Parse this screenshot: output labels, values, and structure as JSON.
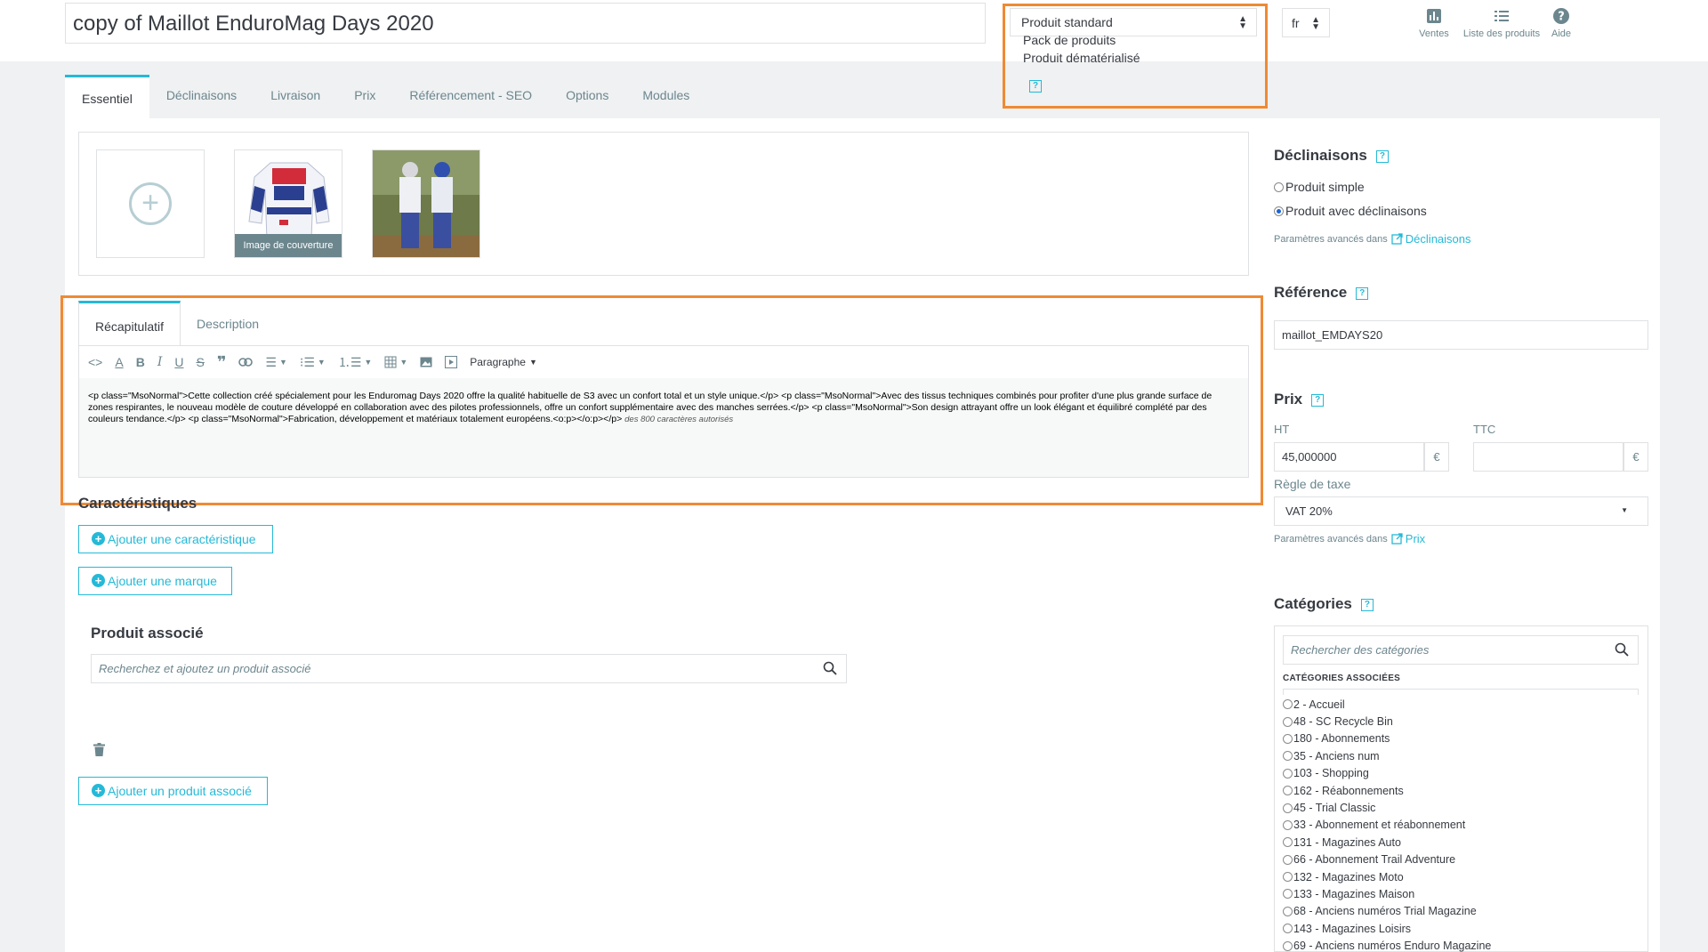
{
  "header": {
    "product_name": "copy of Maillot EnduroMag Days 2020",
    "type_selected": "Produit standard",
    "type_options": [
      "Pack de produits",
      "Produit dématérialisé"
    ],
    "language": "fr",
    "links": [
      {
        "label": "Ventes",
        "icon": "bar-chart-icon"
      },
      {
        "label": "Liste des produits",
        "icon": "list-icon"
      },
      {
        "label": "Aide",
        "icon": "help-icon"
      }
    ]
  },
  "tabs": [
    "Essentiel",
    "Déclinaisons",
    "Livraison",
    "Prix",
    "Référencement - SEO",
    "Options",
    "Modules"
  ],
  "images": {
    "cover_label": "Image de couverture"
  },
  "summary": {
    "tabs": [
      "Récapitulatif",
      "Description"
    ],
    "format_label": "Paragraphe",
    "content": "<p class=\"MsoNormal\">Cette collection créé spécialement pour les Enduromag Days 2020 offre la qualité habituelle de S3 avec un confort total et un style unique.</p> <p class=\"MsoNormal\">Avec des tissus techniques combinés pour profiter d'une plus grande surface de zones respirantes, le nouveau modèle de couture développé en collaboration avec des pilotes professionnels, offre un confort supplémentaire avec des manches serrées.</p> <p class=\"MsoNormal\">Son design attrayant offre un look élégant et équilibré complété par des couleurs tendance.</p> <p class=\"MsoNormal\">Fabrication, développement et matériaux totalement européens.<o:p></o:p></p>",
    "limit_text": "des 800 caractères autorisés"
  },
  "characteristics": {
    "title": "Caractéristiques",
    "add_feature": "Ajouter une caractéristique",
    "add_brand": "Ajouter une marque"
  },
  "related": {
    "title": "Produit associé",
    "placeholder": "Recherchez et ajoutez un produit associé",
    "add_button": "Ajouter un produit associé"
  },
  "variants": {
    "title": "Déclinaisons",
    "option_simple": "Produit simple",
    "option_combinations": "Produit avec déclinaisons",
    "advanced_prefix": "Paramètres avancés dans",
    "advanced_link": "Déclinaisons"
  },
  "reference": {
    "title": "Référence",
    "value": "maillot_EMDAYS20"
  },
  "price": {
    "title": "Prix",
    "ht_label": "HT",
    "ttc_label": "TTC",
    "ht_value": "45,000000",
    "currency": "€",
    "tax_label": "Règle de taxe",
    "tax_value": "VAT 20%",
    "advanced_prefix": "Paramètres avancés dans",
    "advanced_link": "Prix"
  },
  "categories": {
    "title": "Catégories",
    "search_placeholder": "Rechercher des catégories",
    "associated_label": "CATÉGORIES ASSOCIÉES",
    "items": [
      "2 - Accueil",
      "48 - SC Recycle Bin",
      "180 - Abonnements",
      "35 - Anciens num",
      "103 - Shopping",
      "162 - Réabonnements",
      "45 - Trial Classic",
      "33 - Abonnement et réabonnement",
      "131 - Magazines Auto",
      "66 - Abonnement Trail Adventure",
      "132 - Magazines Moto",
      "133 - Magazines Maison",
      "68 - Anciens numéros Trial Magazine",
      "143 - Magazines Loisirs",
      "69 - Anciens numéros Enduro Magazine"
    ]
  },
  "colors": {
    "accent": "#25b9d7",
    "highlight": "#ef8a34",
    "text": "#363a41",
    "muted": "#6c868e"
  }
}
